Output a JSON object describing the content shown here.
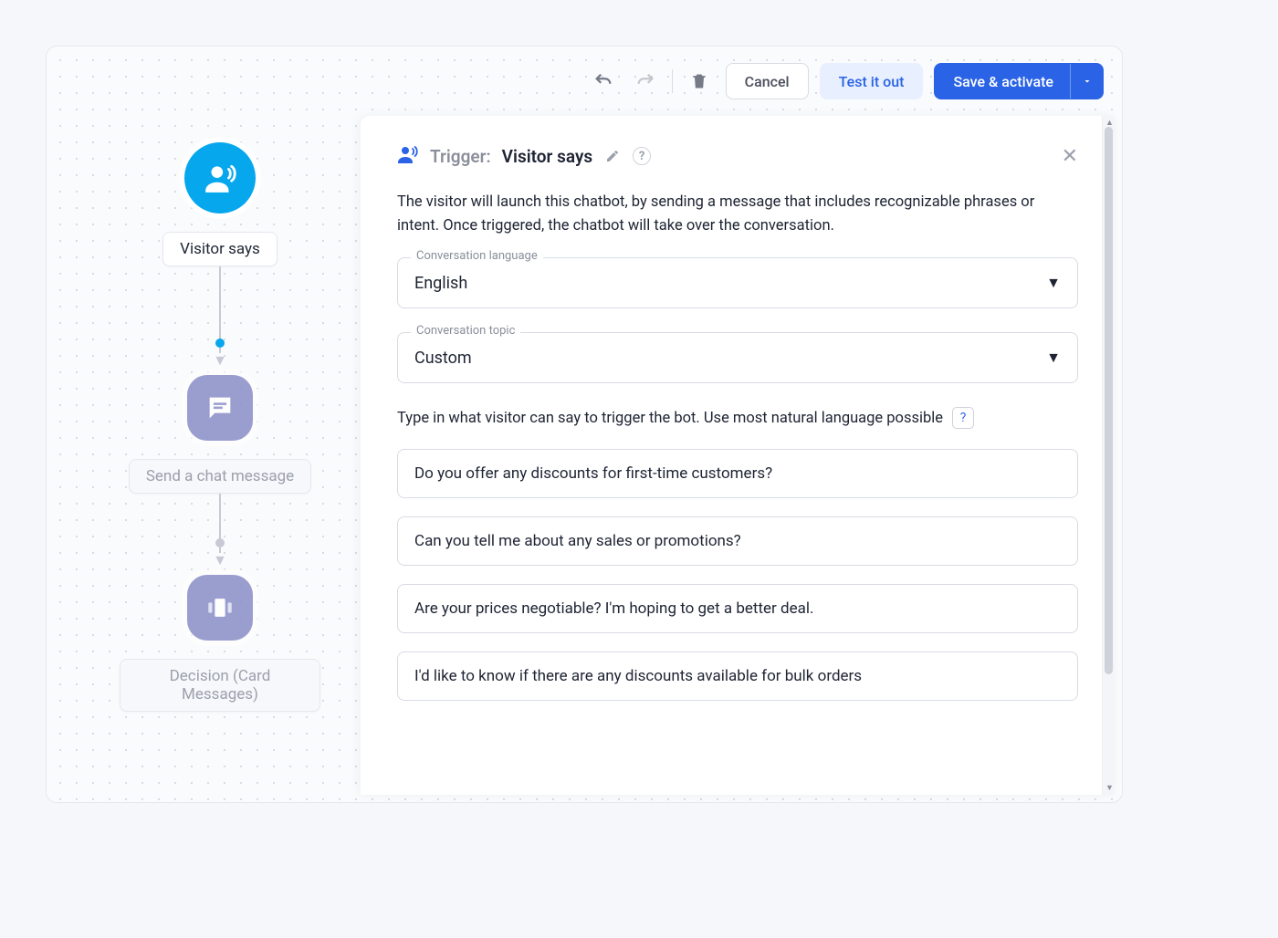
{
  "toolbar": {
    "cancel": "Cancel",
    "test": "Test it out",
    "save": "Save & activate"
  },
  "flow": {
    "node1": "Visitor says",
    "node2": "Send a chat message",
    "node3": "Decision (Card Messages)"
  },
  "panel": {
    "trigger_label": "Trigger:",
    "trigger_value": "Visitor says",
    "description": "The visitor will launch this chatbot, by sending a message that includes recognizable phrases or intent. Once triggered, the chatbot will take over the conversation.",
    "lang_label": "Conversation language",
    "lang_value": "English",
    "topic_label": "Conversation topic",
    "topic_value": "Custom",
    "hint": "Type in what visitor can say to trigger the bot. Use most natural language possible",
    "phrases": [
      "Do you offer any discounts for first-time customers?",
      "Can you tell me about any sales or promotions?",
      "Are your prices negotiable? I'm hoping to get a better deal.",
      "I'd like to know if there are any discounts available for bulk orders"
    ]
  }
}
